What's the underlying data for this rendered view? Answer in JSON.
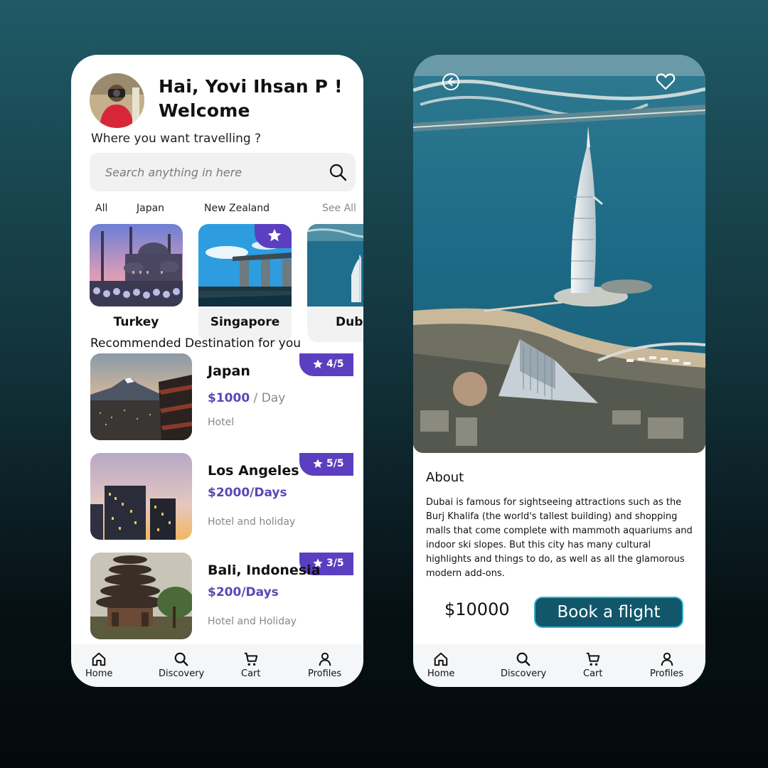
{
  "colors": {
    "accent_purple": "#5b3fc0",
    "price_purple": "#5848b5",
    "button_teal": "#11566b",
    "button_border": "#35b3c9"
  },
  "home": {
    "greeting_line1": "Hai, Yovi Ihsan P !",
    "greeting_line2": "Welcome",
    "subtitle": "Where you want travelling ?",
    "search_placeholder": "Search anything in here",
    "filters": [
      "All",
      "Japan",
      "New Zealand"
    ],
    "see_all": "See All",
    "destinations": [
      {
        "name": "Turkey",
        "favorite": false
      },
      {
        "name": "Singapore",
        "favorite": true
      },
      {
        "name": "Dubai",
        "favorite": false
      }
    ],
    "recommended_title": "Recommended Destination for you",
    "recommended": [
      {
        "name": "Japan",
        "price": "$1000",
        "unit": " / Day",
        "tag": "Hotel",
        "rating": "4/5"
      },
      {
        "name": "Los Angeles",
        "price": "$2000/Days",
        "unit": "",
        "tag": "Hotel and holiday",
        "rating": "5/5"
      },
      {
        "name": "Bali, Indonesia",
        "price": "$200/Days",
        "unit": "",
        "tag": "Hotel and Holiday",
        "rating": "3/5"
      }
    ]
  },
  "detail": {
    "about_title": "About",
    "about_text": "Dubai is famous for sightseeing attractions such as the Burj Khalifa (the world's tallest building) and shopping malls that come complete with mammoth aquariums and indoor ski slopes. But this city has many cultural highlights and things to do, as well as all the glamorous modern add-ons.",
    "price": "$10000",
    "book_button": "Book a flight"
  },
  "nav": {
    "items": [
      {
        "label": "Home",
        "icon": "home-icon"
      },
      {
        "label": "Discovery",
        "icon": "search-icon"
      },
      {
        "label": "Cart",
        "icon": "cart-icon"
      },
      {
        "label": "Profiles",
        "icon": "user-icon"
      }
    ]
  }
}
